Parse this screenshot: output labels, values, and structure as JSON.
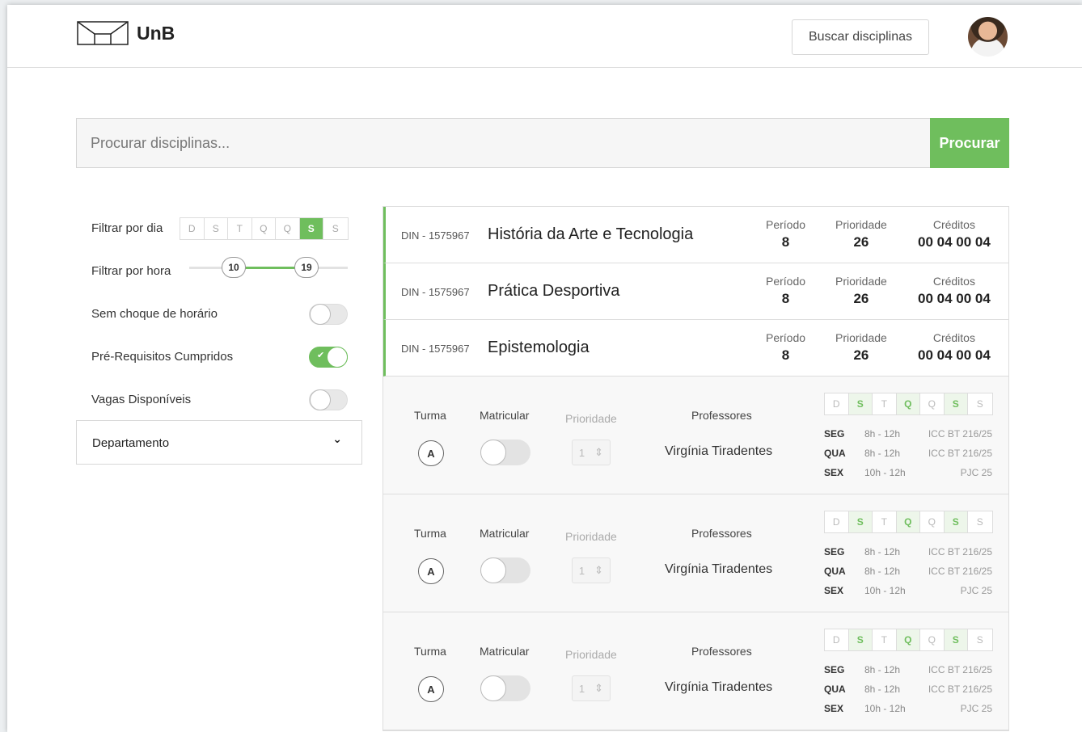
{
  "header": {
    "logo_text": "UnB",
    "buscar_label": "Buscar disciplinas"
  },
  "search": {
    "placeholder": "Procurar disciplinas...",
    "button_label": "Procurar"
  },
  "filters": {
    "dia_label": "Filtrar por dia",
    "days": [
      "D",
      "S",
      "T",
      "Q",
      "Q",
      "S",
      "S"
    ],
    "active_day_index": 5,
    "hora_label": "Filtrar por hora",
    "hora_min": "10",
    "hora_max": "19",
    "toggles": [
      {
        "label": "Sem choque de horário",
        "on": false
      },
      {
        "label": "Pré-Requisitos Cumpridos",
        "on": true
      },
      {
        "label": "Vagas Disponíveis",
        "on": false
      }
    ],
    "departamento_label": "Departamento"
  },
  "stat_labels": {
    "periodo": "Período",
    "prioridade": "Prioridade",
    "creditos": "Créditos"
  },
  "courses": [
    {
      "code": "DIN - 1575967",
      "name": "História da Arte e Tecnologia",
      "periodo": "8",
      "prioridade": "26",
      "creditos": "00 04 00 04"
    },
    {
      "code": "DIN - 1575967",
      "name": "Prática Desportiva",
      "periodo": "8",
      "prioridade": "26",
      "creditos": "00 04 00 04"
    },
    {
      "code": "DIN - 1575967",
      "name": "Epistemologia",
      "periodo": "8",
      "prioridade": "26",
      "creditos": "00 04 00 04"
    }
  ],
  "turma_labels": {
    "turma": "Turma",
    "matricular": "Matricular",
    "prioridade": "Prioridade",
    "professores": "Professores"
  },
  "turmas": [
    {
      "letter": "A",
      "prioridade": "1",
      "professor": "Virgínia Tiradentes",
      "days": [
        "D",
        "S",
        "T",
        "Q",
        "Q",
        "S",
        "S"
      ],
      "active_days": [
        1,
        3,
        5
      ],
      "schedule": [
        {
          "day": "SEG",
          "hours": "8h - 12h",
          "room": "ICC BT 216/25"
        },
        {
          "day": "QUA",
          "hours": "8h - 12h",
          "room": "ICC BT 216/25"
        },
        {
          "day": "SEX",
          "hours": "10h - 12h",
          "room": "PJC 25"
        }
      ]
    },
    {
      "letter": "A",
      "prioridade": "1",
      "professor": "Virgínia Tiradentes",
      "days": [
        "D",
        "S",
        "T",
        "Q",
        "Q",
        "S",
        "S"
      ],
      "active_days": [
        1,
        3,
        5
      ],
      "schedule": [
        {
          "day": "SEG",
          "hours": "8h - 12h",
          "room": "ICC BT 216/25"
        },
        {
          "day": "QUA",
          "hours": "8h - 12h",
          "room": "ICC BT 216/25"
        },
        {
          "day": "SEX",
          "hours": "10h - 12h",
          "room": "PJC 25"
        }
      ]
    },
    {
      "letter": "A",
      "prioridade": "1",
      "professor": "Virgínia Tiradentes",
      "days": [
        "D",
        "S",
        "T",
        "Q",
        "Q",
        "S",
        "S"
      ],
      "active_days": [
        1,
        3,
        5
      ],
      "schedule": [
        {
          "day": "SEG",
          "hours": "8h - 12h",
          "room": "ICC BT 216/25"
        },
        {
          "day": "QUA",
          "hours": "8h - 12h",
          "room": "ICC BT 216/25"
        },
        {
          "day": "SEX",
          "hours": "10h - 12h",
          "room": "PJC 25"
        }
      ]
    }
  ]
}
